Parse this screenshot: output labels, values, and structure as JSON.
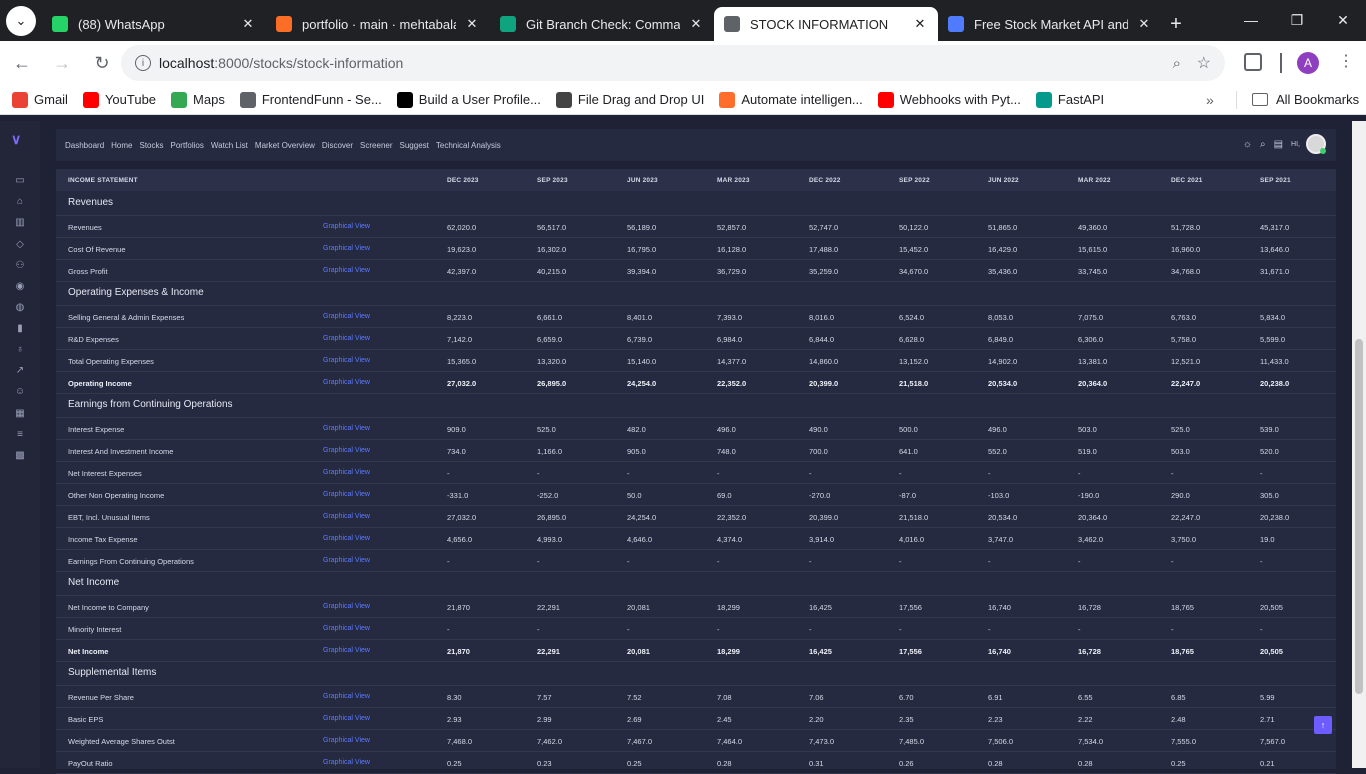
{
  "browser": {
    "tabs": [
      {
        "title": "(88) WhatsApp",
        "icon": "whatsapp-icon",
        "color": "#25d366"
      },
      {
        "title": "portfolio · main · mehtabalam",
        "icon": "gitlab-icon",
        "color": "#fc6d26"
      },
      {
        "title": "Git Branch Check: Command",
        "icon": "chatgpt-icon",
        "color": "#10a37f"
      },
      {
        "title": "STOCK INFORMATION",
        "icon": "globe-icon",
        "color": "#5f6368",
        "active": true
      },
      {
        "title": "Free Stock Market API and Fi",
        "icon": "api-icon",
        "color": "#4f7cff"
      }
    ],
    "url_host": "localhost",
    "url_path": ":8000/stocks/stock-information",
    "bookmarks": [
      {
        "label": "Gmail",
        "color": "#ea4335"
      },
      {
        "label": "YouTube",
        "color": "#ff0000"
      },
      {
        "label": "Maps",
        "color": "#34a853"
      },
      {
        "label": "FrontendFunn - Se...",
        "color": "#5f6368"
      },
      {
        "label": "Build a User Profile...",
        "color": "#000000"
      },
      {
        "label": "File Drag and Drop UI",
        "color": "#444444"
      },
      {
        "label": "Automate intelligen...",
        "color": "#ff6d2d"
      },
      {
        "label": "Webhooks with Pyt...",
        "color": "#ff0000"
      },
      {
        "label": "FastAPI",
        "color": "#05998b"
      }
    ],
    "all_bookmarks": "All Bookmarks"
  },
  "nav": {
    "links": [
      "Dashboard",
      "Home",
      "Stocks",
      "Portfolios",
      "Watch List",
      "Market Overview",
      "Discover",
      "Screener",
      "Suggest",
      "Technical Analysis"
    ],
    "lang": "HI,"
  },
  "table": {
    "header": "INCOME STATEMENT",
    "periods": [
      "DEC 2023",
      "SEP 2023",
      "JUN 2023",
      "MAR 2023",
      "DEC 2022",
      "SEP 2022",
      "JUN 2022",
      "MAR 2022",
      "DEC 2021",
      "SEP 2021"
    ],
    "link_label": "Graphical View",
    "sections": [
      {
        "title": "Revenues",
        "rows": [
          {
            "label": "Revenues",
            "values": [
              "62,020.0",
              "56,517.0",
              "56,189.0",
              "52,857.0",
              "52,747.0",
              "50,122.0",
              "51,865.0",
              "49,360.0",
              "51,728.0",
              "45,317.0"
            ]
          },
          {
            "label": "Cost Of Revenue",
            "values": [
              "19,623.0",
              "16,302.0",
              "16,795.0",
              "16,128.0",
              "17,488.0",
              "15,452.0",
              "16,429.0",
              "15,615.0",
              "16,960.0",
              "13,646.0"
            ]
          },
          {
            "label": "Gross Profit",
            "values": [
              "42,397.0",
              "40,215.0",
              "39,394.0",
              "36,729.0",
              "35,259.0",
              "34,670.0",
              "35,436.0",
              "33,745.0",
              "34,768.0",
              "31,671.0"
            ]
          }
        ]
      },
      {
        "title": "Operating Expenses & Income",
        "rows": [
          {
            "label": "Selling General & Admin Expenses",
            "values": [
              "8,223.0",
              "6,661.0",
              "8,401.0",
              "7,393.0",
              "8,016.0",
              "6,524.0",
              "8,053.0",
              "7,075.0",
              "6,763.0",
              "5,834.0"
            ]
          },
          {
            "label": "R&D Expenses",
            "values": [
              "7,142.0",
              "6,659.0",
              "6,739.0",
              "6,984.0",
              "6,844.0",
              "6,628.0",
              "6,849.0",
              "6,306.0",
              "5,758.0",
              "5,599.0"
            ]
          },
          {
            "label": "Total Operating Expenses",
            "values": [
              "15,365.0",
              "13,320.0",
              "15,140.0",
              "14,377.0",
              "14,860.0",
              "13,152.0",
              "14,902.0",
              "13,381.0",
              "12,521.0",
              "11,433.0"
            ]
          },
          {
            "label": "Operating Income",
            "bold": true,
            "values": [
              "27,032.0",
              "26,895.0",
              "24,254.0",
              "22,352.0",
              "20,399.0",
              "21,518.0",
              "20,534.0",
              "20,364.0",
              "22,247.0",
              "20,238.0"
            ]
          }
        ]
      },
      {
        "title": "Earnings from Continuing Operations",
        "rows": [
          {
            "label": "Interest Expense",
            "values": [
              "909.0",
              "525.0",
              "482.0",
              "496.0",
              "490.0",
              "500.0",
              "496.0",
              "503.0",
              "525.0",
              "539.0"
            ]
          },
          {
            "label": "Interest And Investment Income",
            "values": [
              "734.0",
              "1,166.0",
              "905.0",
              "748.0",
              "700.0",
              "641.0",
              "552.0",
              "519.0",
              "503.0",
              "520.0"
            ]
          },
          {
            "label": "Net Interest Expenses",
            "values": [
              "-",
              "-",
              "-",
              "-",
              "-",
              "-",
              "-",
              "-",
              "-",
              "-"
            ]
          },
          {
            "label": "Other Non Operating Income",
            "values": [
              "-331.0",
              "-252.0",
              "50.0",
              "69.0",
              "-270.0",
              "-87.0",
              "-103.0",
              "-190.0",
              "290.0",
              "305.0"
            ]
          },
          {
            "label": "EBT, Incl. Unusual Items",
            "values": [
              "27,032.0",
              "26,895.0",
              "24,254.0",
              "22,352.0",
              "20,399.0",
              "21,518.0",
              "20,534.0",
              "20,364.0",
              "22,247.0",
              "20,238.0"
            ]
          },
          {
            "label": "Income Tax Expense",
            "values": [
              "4,656.0",
              "4,993.0",
              "4,646.0",
              "4,374.0",
              "3,914.0",
              "4,016.0",
              "3,747.0",
              "3,462.0",
              "3,750.0",
              "19.0"
            ]
          },
          {
            "label": "Earnings From Continuing Operations",
            "values": [
              "-",
              "-",
              "-",
              "-",
              "-",
              "-",
              "-",
              "-",
              "-",
              "-"
            ]
          }
        ]
      },
      {
        "title": "Net Income",
        "rows": [
          {
            "label": "Net Income to Company",
            "values": [
              "21,870",
              "22,291",
              "20,081",
              "18,299",
              "16,425",
              "17,556",
              "16,740",
              "16,728",
              "18,765",
              "20,505"
            ]
          },
          {
            "label": "Minority Interest",
            "values": [
              "-",
              "-",
              "-",
              "-",
              "-",
              "-",
              "-",
              "-",
              "-",
              "-"
            ]
          },
          {
            "label": "Net Income",
            "bold": true,
            "values": [
              "21,870",
              "22,291",
              "20,081",
              "18,299",
              "16,425",
              "17,556",
              "16,740",
              "16,728",
              "18,765",
              "20,505"
            ]
          }
        ]
      },
      {
        "title": "Supplemental Items",
        "rows": [
          {
            "label": "Revenue Per Share",
            "values": [
              "8.30",
              "7.57",
              "7.52",
              "7.08",
              "7.06",
              "6.70",
              "6.91",
              "6.55",
              "6.85",
              "5.99"
            ]
          },
          {
            "label": "Basic EPS",
            "values": [
              "2.93",
              "2.99",
              "2.69",
              "2.45",
              "2.20",
              "2.35",
              "2.23",
              "2.22",
              "2.48",
              "2.71"
            ]
          },
          {
            "label": "Weighted Average Shares Outst",
            "values": [
              "7,468.0",
              "7,462.0",
              "7,467.0",
              "7,464.0",
              "7,473.0",
              "7,485.0",
              "7,506.0",
              "7,534.0",
              "7,555.0",
              "7,567.0"
            ]
          },
          {
            "label": "PayOut Ratio",
            "values": [
              "0.25",
              "0.23",
              "0.25",
              "0.28",
              "0.31",
              "0.26",
              "0.28",
              "0.28",
              "0.25",
              "0.21"
            ]
          }
        ]
      }
    ]
  },
  "scroll_top_label": "↑"
}
